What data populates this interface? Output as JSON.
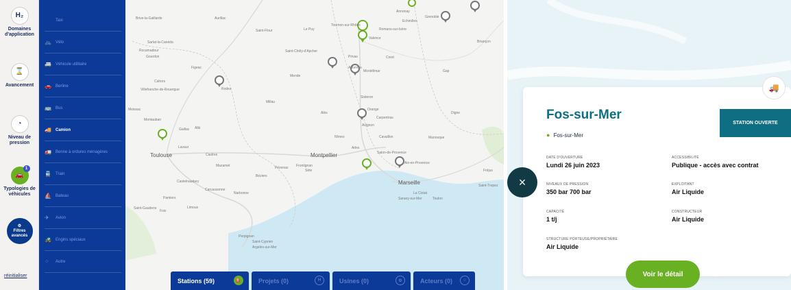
{
  "rail": {
    "items": [
      {
        "icon": "H₂",
        "label": "Domaines d'application"
      },
      {
        "icon": "⌛",
        "label": "Avancement"
      },
      {
        "icon": "◔",
        "label": "Niveau de pression"
      },
      {
        "icon": "🚗",
        "label": "Typologies de véhicules",
        "badge": "1"
      },
      {
        "icon": "⚙",
        "label": "Filtres avancés"
      }
    ],
    "reset_label": "réinitialiser"
  },
  "menu": {
    "items": [
      {
        "label": "Taxi",
        "icon": ""
      },
      {
        "label": "Vélo",
        "icon": "🚲"
      },
      {
        "label": "Véhicule utilitaire",
        "icon": "🚐"
      },
      {
        "label": "Berline",
        "icon": "🚗"
      },
      {
        "label": "Bus",
        "icon": "🚌"
      },
      {
        "label": "Camion",
        "icon": "🚚",
        "active": true
      },
      {
        "label": "Benne à ordures ménagères",
        "icon": "🚛"
      },
      {
        "label": "Train",
        "icon": "🚆"
      },
      {
        "label": "Bateau",
        "icon": "⛵"
      },
      {
        "label": "Avion",
        "icon": "✈"
      },
      {
        "label": "Engins spéciaux",
        "icon": "🚜"
      },
      {
        "label": "Autre",
        "icon": "⁘"
      }
    ]
  },
  "map": {
    "cities": [
      {
        "name": "Toulouse",
        "big": true
      },
      {
        "name": "Montpellier",
        "big": true
      },
      {
        "name": "Marseille",
        "big": true
      },
      {
        "name": "Valence"
      },
      {
        "name": "Avignon"
      },
      {
        "name": "Nîmes"
      },
      {
        "name": "Arles"
      },
      {
        "name": "Aix-en-Provence"
      },
      {
        "name": "Montauban"
      },
      {
        "name": "Rodez"
      },
      {
        "name": "Albi"
      },
      {
        "name": "Castres"
      },
      {
        "name": "Carcassonne"
      },
      {
        "name": "Narbonne"
      },
      {
        "name": "Béziers"
      },
      {
        "name": "Perpignan"
      },
      {
        "name": "Toulon"
      },
      {
        "name": "Gap"
      },
      {
        "name": "Digne"
      },
      {
        "name": "Orange"
      },
      {
        "name": "Carpentras"
      },
      {
        "name": "Cahors"
      },
      {
        "name": "Figeac"
      },
      {
        "name": "Mende"
      },
      {
        "name": "Aubenas"
      },
      {
        "name": "Montélimar"
      },
      {
        "name": "Privas"
      },
      {
        "name": "Le Puy"
      },
      {
        "name": "Annonay"
      },
      {
        "name": "Tournon-sur-Rhône"
      },
      {
        "name": "Romans-sur-Isère"
      },
      {
        "name": "Crest"
      },
      {
        "name": "Sisteron"
      },
      {
        "name": "Cavaillon"
      },
      {
        "name": "Salon-de-Provence"
      },
      {
        "name": "Manosque"
      },
      {
        "name": "Fréjus"
      },
      {
        "name": "Saint-Tropez"
      },
      {
        "name": "La Ciotat"
      },
      {
        "name": "Aurillac"
      },
      {
        "name": "Millau"
      },
      {
        "name": "Alès"
      },
      {
        "name": "Sète"
      },
      {
        "name": "Lavaur"
      },
      {
        "name": "Mazamet"
      },
      {
        "name": "Pamiers"
      },
      {
        "name": "Limoux"
      },
      {
        "name": "Foix"
      },
      {
        "name": "Saint-Gaudens"
      },
      {
        "name": "Saint-Flour"
      },
      {
        "name": "Villefranche-de-Rouergue"
      },
      {
        "name": "Gaillac"
      },
      {
        "name": "Moissac"
      },
      {
        "name": "Castelnaudary"
      },
      {
        "name": "Saint-Cyprien"
      },
      {
        "name": "Argelès-sur-Mer"
      },
      {
        "name": "Frontignan"
      },
      {
        "name": "Pézenas"
      },
      {
        "name": "Sanary-sur-Mer"
      },
      {
        "name": "Briançon"
      },
      {
        "name": "Echirolles"
      },
      {
        "name": "Grenoble"
      },
      {
        "name": "Sisteron"
      },
      {
        "name": "Brive-la-Gaillarde"
      },
      {
        "name": "Sarlat-la-Canéda"
      },
      {
        "name": "Rocamadour"
      },
      {
        "name": "Gourdon"
      },
      {
        "name": "Saint-Chély-d'Apcher"
      }
    ]
  },
  "tabs": [
    {
      "label": "Stations (59)",
      "active": true
    },
    {
      "label": "Projets (0)",
      "active": false
    },
    {
      "label": "Usines (0)",
      "active": false
    },
    {
      "label": "Acteurs (0)",
      "active": false
    }
  ],
  "station": {
    "name": "Fos-sur-Mer",
    "location": "Fos-sur-Mer",
    "status": "STATION OUVERTE",
    "fields": {
      "opening_date": {
        "label": "DATE D'OUVERTURE",
        "value": "Lundi 26 juin 2023"
      },
      "accessibility": {
        "label": "ACCESSIBILITÉ",
        "value": "Publique - accès avec contrat"
      },
      "pressure": {
        "label": "NIVEAUX DE PRESSION",
        "value": "350 bar 700 bar"
      },
      "operator": {
        "label": "EXPLOITANT",
        "value": "Air Liquide"
      },
      "capacity": {
        "label": "CAPACITÉ",
        "value": "1 t/j"
      },
      "builder": {
        "label": "CONSTRUCTEUR",
        "value": "Air Liquide"
      },
      "owner": {
        "label": "STRUCTURE PORTEUSE/PROPRIÉTAIRE",
        "value": "Air Liquide"
      }
    },
    "detail_button": "Voir le détail",
    "close_icon": "×",
    "truck_icon": "truck-icon"
  },
  "colors": {
    "navy": "#0b3a99",
    "green": "#6ab023",
    "teal": "#0f6f82",
    "sea": "#cfe9f4"
  }
}
